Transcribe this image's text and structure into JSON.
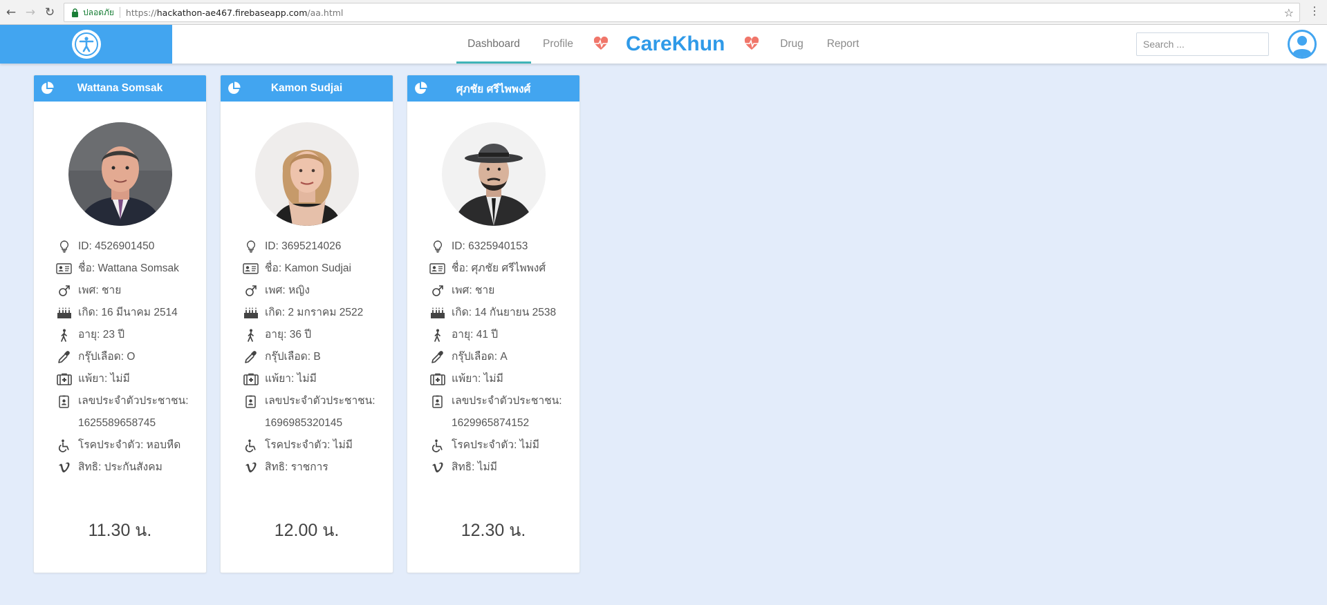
{
  "browser": {
    "secure_label": "ปลอดภัย",
    "url_prefix": "https://",
    "url_host": "hackathon-ae467.firebaseapp.com",
    "url_path": "/aa.html"
  },
  "header": {
    "nav": {
      "dashboard": "Dashboard",
      "profile": "Profile",
      "drug": "Drug",
      "report": "Report"
    },
    "logo": "CareKhun",
    "search_placeholder": "Search ...",
    "accent_color": "#42a5f0",
    "active_underline_color": "#3fb4b8"
  },
  "cards": [
    {
      "name": "Wattana Somsak",
      "id_line": "ID: 4526901450",
      "name_line": "ชื่อ: Wattana Somsak",
      "sex_line": "เพศ: ชาย",
      "born_line": "เกิด: 16 มีนาคม 2514",
      "age_line": "อายุ: 23 ปี",
      "blood_line": "กรุ๊ปเลือด: O",
      "allergy_line": "แพ้ยา: ไม่มี",
      "citizen_label": "เลขประจำตัวประชาชน:",
      "citizen_no": "1625589658745",
      "disease_line": "โรคประจำตัว: หอบหืด",
      "right_line": "สิทธิ: ประกันสังคม",
      "time": "11.30 น."
    },
    {
      "name": "Kamon Sudjai",
      "id_line": "ID: 3695214026",
      "name_line": "ชื่อ: Kamon Sudjai",
      "sex_line": "เพศ: หญิง",
      "born_line": "เกิด: 2 มกราคม 2522",
      "age_line": "อายุ: 36 ปี",
      "blood_line": "กรุ๊ปเลือด: B",
      "allergy_line": "แพ้ยา: ไม่มี",
      "citizen_label": "เลขประจำตัวประชาชน:",
      "citizen_no": "1696985320145",
      "disease_line": "โรคประจำตัว: ไม่มี",
      "right_line": "สิทธิ: ราชการ",
      "time": "12.00 น."
    },
    {
      "name": "ศุภชัย ศรีไพพงศ์",
      "id_line": "ID: 6325940153",
      "name_line": "ชื่อ: ศุภชัย ศรีไพพงศ์",
      "sex_line": "เพศ: ชาย",
      "born_line": "เกิด: 14 กันยายน 2538",
      "age_line": "อายุ: 41 ปี",
      "blood_line": "กรุ๊ปเลือด: A",
      "allergy_line": "แพ้ยา: ไม่มี",
      "citizen_label": "เลขประจำตัวประชาชน:",
      "citizen_no": "1629965874152",
      "disease_line": "โรคประจำตัว: ไม่มี",
      "right_line": "สิทธิ: ไม่มี",
      "time": "12.30 น."
    }
  ]
}
